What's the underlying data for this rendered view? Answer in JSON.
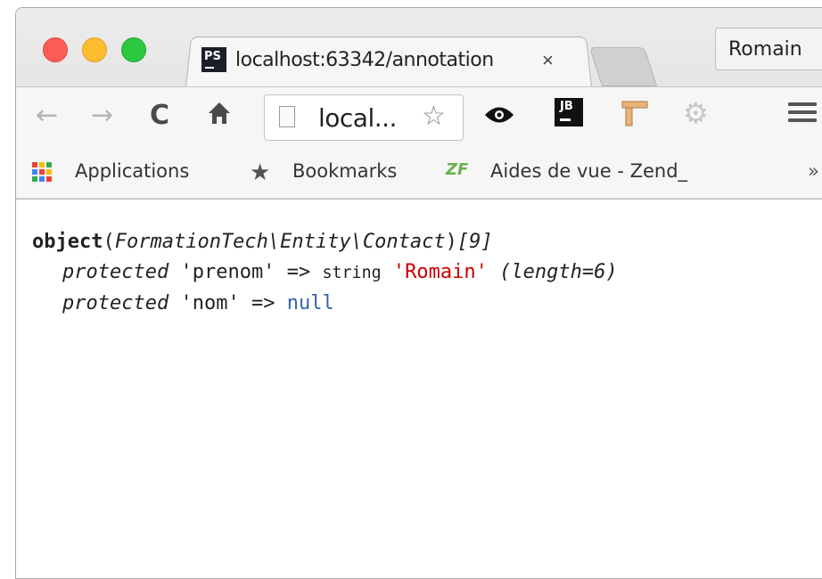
{
  "window": {
    "controls": [
      "close",
      "minimize",
      "zoom"
    ],
    "colors": {
      "close": "#fd5d55",
      "minimize": "#fdbc2e",
      "zoom": "#2bc840"
    }
  },
  "tab": {
    "favicon": "phpstorm-icon",
    "favicon_text": "PS",
    "title": "localhost:63342/annotation",
    "close": "×"
  },
  "profile": {
    "name": "Romain"
  },
  "toolbar": {
    "back": "←",
    "forward": "→",
    "reload": "C",
    "home": "ft",
    "url": "local...",
    "bookmark_star": "☆",
    "extensions": [
      "eye-icon",
      "jetbrains-icon",
      "tool-icon",
      "gear-icon"
    ],
    "jb_text": "JB"
  },
  "bookmarks": {
    "apps_label": "Applications",
    "bookmarks_label": "Bookmarks",
    "zf_icon_text": "ZF",
    "zend_label": "Aides de vue - Zend_",
    "more": "»"
  },
  "dump": {
    "keyword": "object",
    "class_name": "FormationTech\\Entity\\Contact",
    "id": "[9]",
    "props": [
      {
        "visibility": "protected",
        "name": "'prenom'",
        "arrow": "=>",
        "type": "string",
        "value": "'Romain'",
        "extra": "(length=6)"
      },
      {
        "visibility": "protected",
        "name": "'nom'",
        "arrow": "=>",
        "value": "null"
      }
    ]
  }
}
